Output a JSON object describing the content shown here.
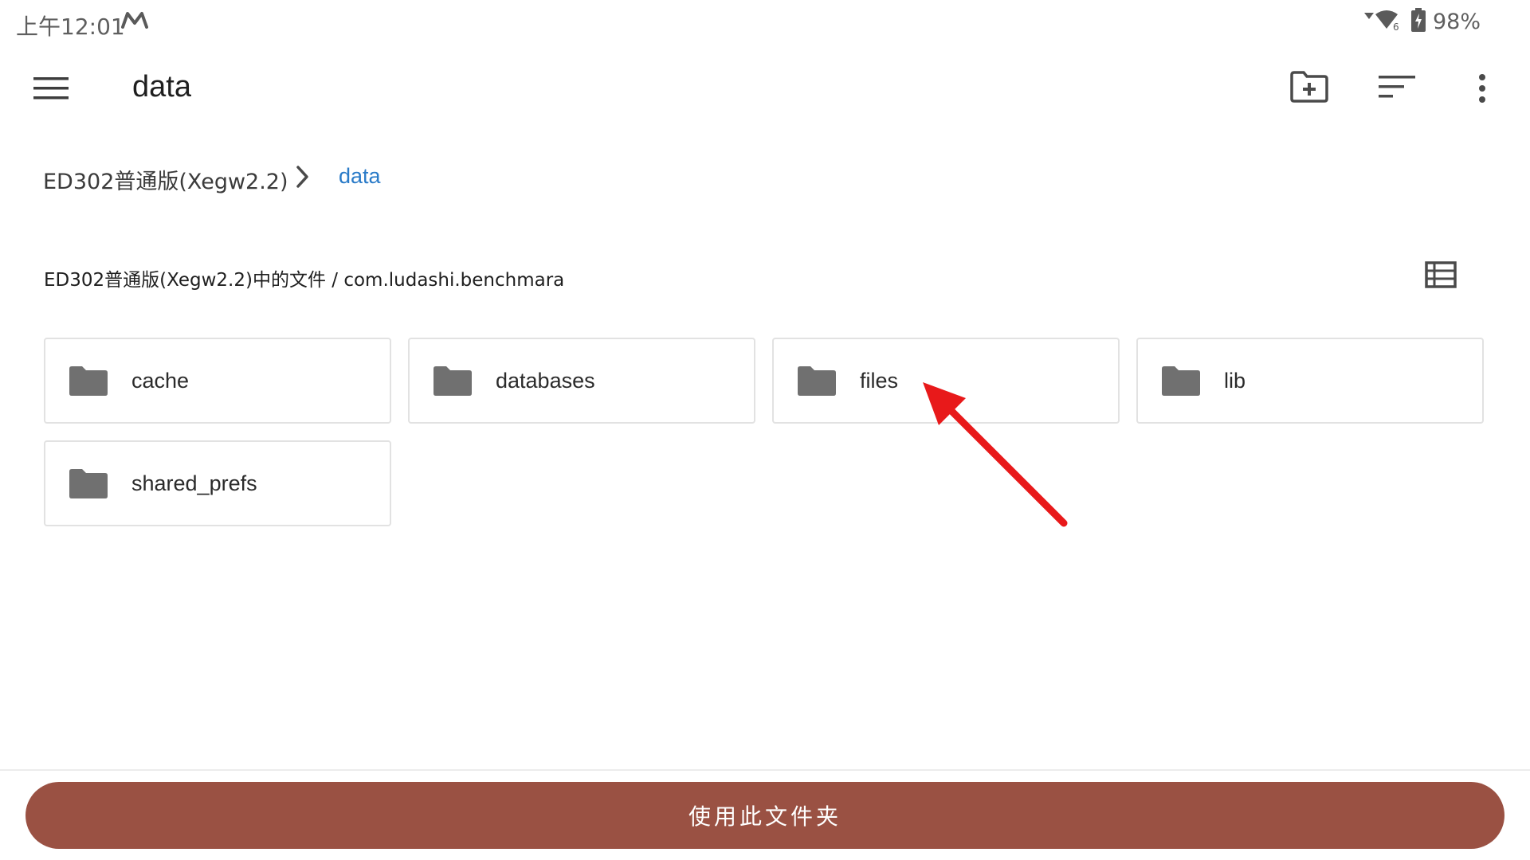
{
  "status_bar": {
    "time": "上午12:01",
    "notification_icon": "m-logo-icon",
    "signal_icon": "wifi-icon",
    "battery_icon": "battery-charging-icon",
    "battery": "98%"
  },
  "app_bar": {
    "menu_icon": "hamburger-icon",
    "title": "data",
    "actions": [
      "new-folder-icon",
      "sort-icon",
      "more-vert-icon"
    ]
  },
  "breadcrumb": {
    "root": "ED302普通版(Xegw2.2)",
    "separator_icon": "chevron-right-icon",
    "current": "data"
  },
  "path_header": {
    "text": "ED302普通版(Xegw2.2)中的文件 / com.ludashi.benchmara",
    "view_toggle_icon": "list-view-icon"
  },
  "folders": [
    {
      "name": "cache"
    },
    {
      "name": "databases"
    },
    {
      "name": "files"
    },
    {
      "name": "lib"
    },
    {
      "name": "shared_prefs"
    }
  ],
  "bottom_button": {
    "label": "使用此文件夹"
  },
  "colors": {
    "accent_link": "#2a7bc8",
    "button_bg": "#9a5143",
    "folder_icon": "#707070",
    "annotation_arrow": "#e8191a"
  }
}
